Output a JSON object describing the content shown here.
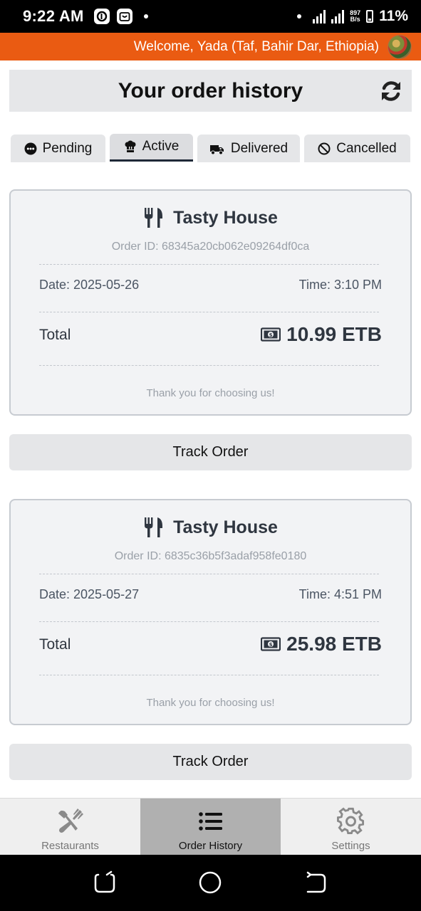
{
  "status_bar": {
    "time": "9:22 AM",
    "net_speed_value": "897",
    "net_speed_unit": "B/s",
    "battery": "11%"
  },
  "welcome": {
    "text": "Welcome, Yada (Taf, Bahir Dar, Ethiopia)"
  },
  "header": {
    "title": "Your order history"
  },
  "tabs": [
    {
      "label": "Pending",
      "icon": "dots-circle-icon"
    },
    {
      "label": "Active",
      "icon": "chef-hat-icon"
    },
    {
      "label": "Delivered",
      "icon": "truck-icon"
    },
    {
      "label": "Cancelled",
      "icon": "ban-icon"
    }
  ],
  "active_tab": "Active",
  "orders": [
    {
      "restaurant": "Tasty House",
      "order_id": "Order ID: 68345a20cb062e09264df0ca",
      "date": "Date: 2025-05-26",
      "time": "Time: 3:10 PM",
      "total_label": "Total",
      "total": "10.99 ETB",
      "thanks": "Thank you for choosing us!",
      "track_label": "Track Order"
    },
    {
      "restaurant": "Tasty House",
      "order_id": "Order ID: 6835c36b5f3adaf958fe0180",
      "date": "Date: 2025-05-27",
      "time": "Time: 4:51 PM",
      "total_label": "Total",
      "total": "25.98 ETB",
      "thanks": "Thank you for choosing us!",
      "track_label": "Track Order"
    }
  ],
  "bottom_nav": [
    {
      "label": "Restaurants",
      "icon": "utensils-crossed-icon"
    },
    {
      "label": "Order History",
      "icon": "list-icon"
    },
    {
      "label": "Settings",
      "icon": "gear-icon"
    }
  ],
  "bottom_nav_active": "Order History",
  "colors": {
    "accent": "#ea5b12",
    "card_bg": "#f2f3f5",
    "button_bg": "#e5e6e8"
  }
}
